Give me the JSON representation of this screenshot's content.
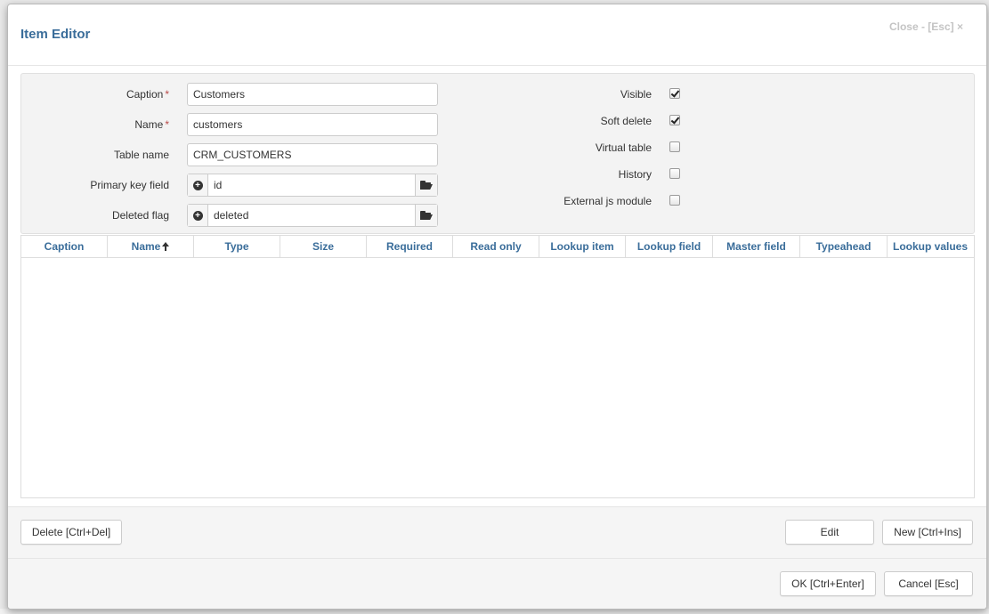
{
  "modal": {
    "title": "Item Editor",
    "close_label": "Close - [Esc] ×"
  },
  "form": {
    "caption": {
      "label": "Caption",
      "required": "*",
      "value": "Customers"
    },
    "name": {
      "label": "Name",
      "required": "*",
      "value": "customers"
    },
    "table_name": {
      "label": "Table name",
      "value": "CRM_CUSTOMERS"
    },
    "primary_key_field": {
      "label": "Primary key field",
      "value": "id"
    },
    "deleted_flag": {
      "label": "Deleted flag",
      "value": "deleted"
    },
    "visible": {
      "label": "Visible",
      "checked": true
    },
    "soft_delete": {
      "label": "Soft delete",
      "checked": true
    },
    "virtual_table": {
      "label": "Virtual table",
      "checked": false
    },
    "history": {
      "label": "History",
      "checked": false
    },
    "external_js_module": {
      "label": "External js module",
      "checked": false
    }
  },
  "grid": {
    "columns": [
      "Caption",
      "Name",
      "Type",
      "Size",
      "Required",
      "Read only",
      "Lookup item",
      "Lookup field",
      "Master field",
      "Typeahead",
      "Lookup values"
    ],
    "sorted_column": "Name",
    "sort_direction": "asc",
    "rows": []
  },
  "toolbar": {
    "delete_label": "Delete [Ctrl+Del]",
    "edit_label": "Edit",
    "new_label": "New [Ctrl+Ins]"
  },
  "footer": {
    "ok_label": "OK [Ctrl+Enter]",
    "cancel_label": "Cancel [Esc]"
  },
  "colors": {
    "accent": "#3a6d9a",
    "required": "#b94a48"
  }
}
